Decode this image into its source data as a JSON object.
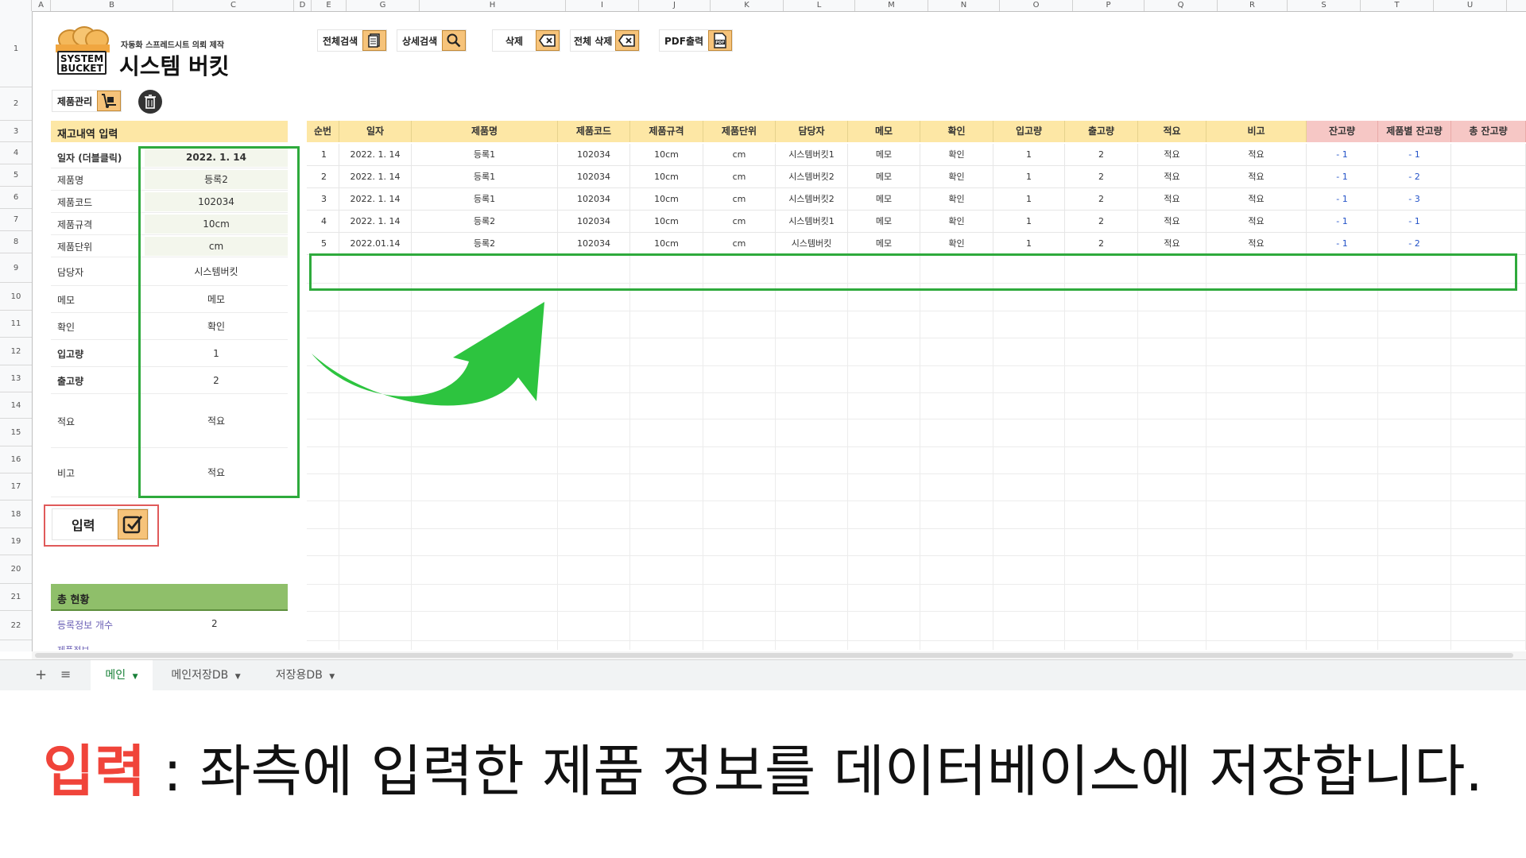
{
  "column_headers": [
    "A",
    "B",
    "C",
    "D",
    "E",
    "G",
    "H",
    "I",
    "J",
    "K",
    "L",
    "M",
    "N",
    "O",
    "P",
    "Q",
    "R",
    "S",
    "T",
    "U"
  ],
  "row_numbers": [
    "1",
    "2",
    "3",
    "4",
    "5",
    "6",
    "7",
    "8",
    "9",
    "10",
    "11",
    "12",
    "13",
    "14",
    "15",
    "16",
    "17",
    "18",
    "19",
    "20",
    "21",
    "22"
  ],
  "brand": {
    "logo_line1": "SYSTEM",
    "logo_line2": "BUCKET",
    "tagline": "자동화 스프레드시트 의뢰 제작",
    "name": "시스템 버킷"
  },
  "toolbar": [
    {
      "label": "전체검색",
      "icon": "document-icon"
    },
    {
      "label": "상세검색",
      "icon": "magnifier-icon"
    },
    {
      "label": "삭제",
      "icon": "backspace-icon"
    },
    {
      "label": "전체 삭제",
      "icon": "backspace-icon"
    },
    {
      "label": "PDF출력",
      "icon": "pdf-icon"
    }
  ],
  "product_manage": {
    "label": "제품관리"
  },
  "input_section": {
    "title": "재고내역 입력",
    "fields": [
      {
        "label": "일자 (더블클릭)",
        "value": "2022. 1. 14"
      },
      {
        "label": "제품명",
        "value": "등록2"
      },
      {
        "label": "제품코드",
        "value": "102034"
      },
      {
        "label": "제품규격",
        "value": "10cm"
      },
      {
        "label": "제품단위",
        "value": "cm"
      },
      {
        "label": "담당자",
        "value": "시스템버킷"
      },
      {
        "label": "메모",
        "value": "메모"
      },
      {
        "label": "확인",
        "value": "확인"
      },
      {
        "label": "입고량",
        "value": "1"
      },
      {
        "label": "출고량",
        "value": "2"
      },
      {
        "label": "적요",
        "value": "적요"
      },
      {
        "label": "비고",
        "value": "적요"
      }
    ],
    "submit_label": "입력"
  },
  "summary": {
    "title": "총 현황",
    "count_label": "등록정보 개수",
    "count_value": "2",
    "next_label": "제품정보"
  },
  "table": {
    "headers": [
      "순번",
      "일자",
      "제품명",
      "제품코드",
      "제품규격",
      "제품단위",
      "담당자",
      "메모",
      "확인",
      "입고량",
      "출고량",
      "적요",
      "비고",
      "잔고량",
      "제품별 잔고량",
      "총 잔고량"
    ],
    "rows": [
      [
        "1",
        "2022. 1. 14",
        "등록1",
        "102034",
        "10cm",
        "cm",
        "시스템버킷1",
        "메모",
        "확인",
        "1",
        "2",
        "적요",
        "적요",
        "- 1",
        "- 1",
        ""
      ],
      [
        "2",
        "2022. 1. 14",
        "등록1",
        "102034",
        "10cm",
        "cm",
        "시스템버킷2",
        "메모",
        "확인",
        "1",
        "2",
        "적요",
        "적요",
        "- 1",
        "- 2",
        ""
      ],
      [
        "3",
        "2022. 1. 14",
        "등록1",
        "102034",
        "10cm",
        "cm",
        "시스템버킷2",
        "메모",
        "확인",
        "1",
        "2",
        "적요",
        "적요",
        "- 1",
        "- 3",
        ""
      ],
      [
        "4",
        "2022. 1. 14",
        "등록2",
        "102034",
        "10cm",
        "cm",
        "시스템버킷1",
        "메모",
        "확인",
        "1",
        "2",
        "적요",
        "적요",
        "- 1",
        "- 1",
        ""
      ],
      [
        "5",
        "2022.01.14",
        "등록2",
        "102034",
        "10cm",
        "cm",
        "시스템버킷",
        "메모",
        "확인",
        "1",
        "2",
        "적요",
        "적요",
        "- 1",
        "- 2",
        ""
      ]
    ]
  },
  "sheet_tabs": [
    {
      "label": "메인",
      "active": true
    },
    {
      "label": "메인저장DB",
      "active": false
    },
    {
      "label": "저장용DB",
      "active": false
    }
  ],
  "caption": {
    "highlight": "입력",
    "text": " : 좌측에 입력한 제품 정보를 데이터베이스에 저장합니다."
  },
  "colors": {
    "header_yellow": "#fde7a5",
    "header_pink": "#f6c7c5",
    "summary_green": "#8fbf6a",
    "highlight_green": "#2eaa3c",
    "arrow_green": "#2dc43f",
    "button_red_frame": "#e05a5a",
    "caption_red": "#f0443a",
    "tab_active_green": "#188038",
    "icon_orange": "#f6c37a"
  }
}
